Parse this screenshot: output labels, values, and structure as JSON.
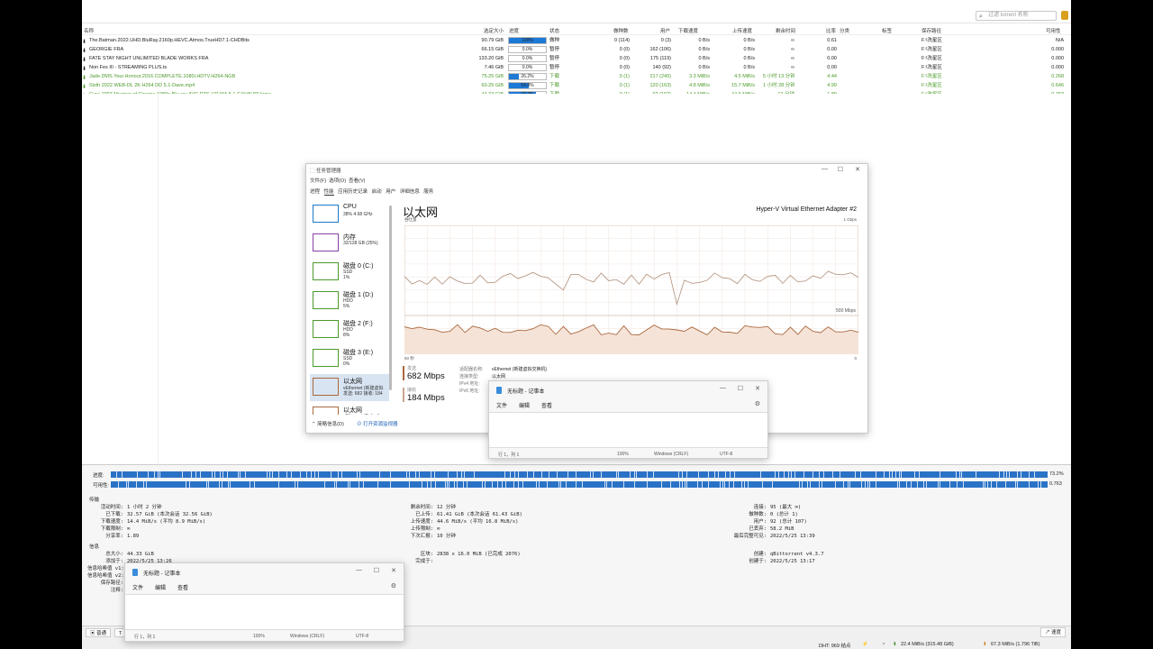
{
  "qb": {
    "search_placeholder": "过滤 torrent 名称",
    "headers": [
      "名称",
      "选定大小",
      "进度",
      "状态",
      "做种数",
      "用户",
      "下载速度",
      "上传速度",
      "剩余时间",
      "比率",
      "分类",
      "标签",
      "保存路径",
      "可用性"
    ],
    "rows": [
      {
        "name": "The.Batman.2022.UHD.BluRay.2160p.HEVC.Atmos.TrueHD7.1-CHDBits",
        "size": "90.79 GiB",
        "progress": 1.0,
        "progress_text": "100%",
        "status": "做种",
        "seeds": "0 (114)",
        "peers": "0 (3)",
        "dl": "0 B/s",
        "ul": "0 B/s",
        "eta": "∞",
        "ratio": "0.61",
        "path": "F:\\洗星区",
        "avail": "N/A",
        "seeding": false
      },
      {
        "name": "GEORGIE FRA",
        "size": "66.15 GiB",
        "progress": 0.0,
        "progress_text": "0.0%",
        "status": "暂停",
        "seeds": "0 (0)",
        "peers": "162 (106)",
        "dl": "0 B/s",
        "ul": "0 B/s",
        "eta": "∞",
        "ratio": "0.00",
        "path": "F:\\洗星区",
        "avail": "0.000",
        "seeding": false
      },
      {
        "name": "FATE STAY NIGHT UNLIMITED BLADE WORKS FRA",
        "size": "133.20 GiB",
        "progress": 0.0,
        "progress_text": "0.0%",
        "status": "暂停",
        "seeds": "0 (0)",
        "peers": "175 (119)",
        "dl": "0 B/s",
        "ul": "0 B/s",
        "eta": "∞",
        "ratio": "0.00",
        "path": "F:\\洗星区",
        "avail": "0.000",
        "seeding": false
      },
      {
        "name": "Non Fes III - STREAMING PLUS.ts",
        "size": "7.46 GiB",
        "progress": 0.0,
        "progress_text": "0.0%",
        "status": "暂停",
        "seeds": "0 (0)",
        "peers": "140 (92)",
        "dl": "0 B/s",
        "ul": "0 B/s",
        "eta": "∞",
        "ratio": "0.00",
        "path": "F:\\洗星区",
        "avail": "0.000",
        "seeding": false
      },
      {
        "name": "Jade.DMS.Your.Honour.2016.COMPLETE.1080i.HDTV.H264-NGB",
        "size": "75.25 GiB",
        "progress": 0.262,
        "progress_text": "26.2%",
        "status": "下载",
        "seeds": "0 (1)",
        "peers": "217 (240)",
        "dl": "3.3 MiB/s",
        "ul": "4.5 MiB/s",
        "eta": "5 小时 13 分钟",
        "ratio": "4.44",
        "path": "F:\\洗星区",
        "avail": "0.268",
        "seeding": true
      },
      {
        "name": "Sixth 2022 WEB-DL 2K H264 DD 5.1-Dave.mp4",
        "size": "60.25 GiB",
        "progress": 0.548,
        "progress_text": "54.8%",
        "status": "下载",
        "seeds": "0 (1)",
        "peers": "120 (163)",
        "dl": "4.8 MiB/s",
        "ul": "15.7 MiB/s",
        "eta": "1 小时 28 分钟",
        "ratio": "4.99",
        "path": "F:\\洗星区",
        "avail": "0.646",
        "seeding": true
      },
      {
        "name": "Cure.1997.Masters.of.Cinema.1080p.Blu-ray.AVC.DTS-HD.MA.5.1-GIY@HDHome",
        "size": "44.33 GiB",
        "progress": 0.732,
        "progress_text": "73.2%",
        "status": "下载",
        "seeds": "0 (1)",
        "peers": "92 (107)",
        "dl": "14.4 MiB/s",
        "ul": "44.6 MiB/s",
        "eta": "12 分钟",
        "ratio": "1.89",
        "path": "F:\\洗星区",
        "avail": "0.763",
        "seeding": true
      }
    ],
    "progress_label": "进度:",
    "progress_value": "73.2%",
    "avail_label": "可用性:",
    "avail_value": "0.763",
    "transfer_header": "传输",
    "transfer_left": [
      {
        "k": "活动时间:",
        "v": "1 小时 2 分钟"
      },
      {
        "k": "已下载:",
        "v": "32.57 GiB (本次会话 32.56 GiB)"
      },
      {
        "k": "下载速度:",
        "v": "14.4 MiB/s (平均 8.9 MiB/s)"
      },
      {
        "k": "下载限制:",
        "v": "∞"
      },
      {
        "k": "分享率:",
        "v": "1.89"
      }
    ],
    "transfer_mid": [
      {
        "k": "剩余时间:",
        "v": "12 分钟"
      },
      {
        "k": "已上传:",
        "v": "61.41 GiB (本次会话 61.43 GiB)"
      },
      {
        "k": "上传速度:",
        "v": "44.6 MiB/s (平均 16.8 MiB/s)"
      },
      {
        "k": "上传限制:",
        "v": "∞"
      },
      {
        "k": "下次汇报:",
        "v": "10 分钟"
      }
    ],
    "transfer_right": [
      {
        "k": "连接:",
        "v": "95 (最大 ∞)"
      },
      {
        "k": "做种数:",
        "v": "0 (总计 1)"
      },
      {
        "k": "用户:",
        "v": "92 (总计 107)"
      },
      {
        "k": "已丢弃:",
        "v": "58.2 MiB"
      },
      {
        "k": "最后完整可见:",
        "v": "2022/5/25 13:39"
      }
    ],
    "info_header": "信息",
    "info_left": [
      {
        "k": "总大小:",
        "v": "44.33 GiB"
      },
      {
        "k": "添加于:",
        "v": "2022/5/25 13:26"
      },
      {
        "k": "信息哈希值 v1:",
        "v": ""
      },
      {
        "k": "信息哈希值 v2:",
        "v": ""
      },
      {
        "k": "保存路径:",
        "v": ""
      },
      {
        "k": "注释:",
        "v": ""
      }
    ],
    "info_mid": [
      {
        "k": "区块:",
        "v": "2838 x 16.0 MiB (已完成 2076)"
      },
      {
        "k": "完成于:",
        "v": ""
      }
    ],
    "info_right": [
      {
        "k": "创建:",
        "v": "qBittorrent v4.3.7"
      },
      {
        "k": "创建于:",
        "v": "2022/5/25 13:17"
      }
    ],
    "tab_general": "普通",
    "tab_second": "T",
    "speed_btn": "速度",
    "sb_dht": "DHT: 969 结点",
    "sb_dl": "22.4 MiB/s (315.48 GiB)",
    "sb_ul": "67.3 MiB/s (1.796 TiB)"
  },
  "tm": {
    "title": "任务管理器",
    "menu": [
      "文件(F)",
      "选项(O)",
      "查看(V)"
    ],
    "tabs": [
      "进程",
      "性能",
      "应用历史记录",
      "启动",
      "用户",
      "详细信息",
      "服务"
    ],
    "side": [
      {
        "name": "CPU",
        "l1": "38% 4.68 GHz",
        "l2": "",
        "l3": "",
        "color": "#1a79c9"
      },
      {
        "name": "内存",
        "l1": "32/128 GB (25%)",
        "l2": "",
        "l3": "",
        "color": "#8b3fa6"
      },
      {
        "name": "磁盘 0 (C:)",
        "l1": "SSD",
        "l2": "1%",
        "l3": "",
        "color": "#4b9a2b"
      },
      {
        "name": "磁盘 1 (D:)",
        "l1": "HDD",
        "l2": "5%",
        "l3": "",
        "color": "#4b9a2b"
      },
      {
        "name": "磁盘 2 (F:)",
        "l1": "HDD",
        "l2": "8%",
        "l3": "",
        "color": "#4b9a2b"
      },
      {
        "name": "磁盘 3 (E:)",
        "l1": "SSD",
        "l2": "0%",
        "l3": "",
        "color": "#4b9a2b"
      },
      {
        "name": "以太网",
        "l1": "vEthernet (新建虚拟",
        "l2": "发送: 682 接收: 184",
        "l3": "",
        "color": "#a9683e"
      },
      {
        "name": "以太网",
        "l1": "vEthernet (Default",
        "l2": "",
        "l3": "",
        "color": "#a9683e"
      }
    ],
    "big_title": "以太网",
    "adapter": "Hyper-V Virtual Ethernet Adapter #2",
    "throughput_label": "吞吐量",
    "max_label": "1 Gbps",
    "mid_label": "500 Mbps",
    "sixty": "60 秒",
    "zero": "0",
    "send_label": "发送",
    "send_value": "682 Mbps",
    "recv_label": "接收",
    "recv_value": "184 Mbps",
    "details": [
      {
        "k": "适配器名称:",
        "v": "vEthernet (新建虚拟交换机)"
      },
      {
        "k": "连接类型:",
        "v": "以太网"
      },
      {
        "k": "IPv4 地址:",
        "v": ""
      },
      {
        "k": "IPv6 地址:",
        "v": ""
      }
    ],
    "less": "简略信息(D)",
    "open_monitor": "打开资源监视器"
  },
  "notepad1": {
    "title": "无标题 - 记事本",
    "menu": [
      "文件",
      "编辑",
      "查看"
    ],
    "pos": "行 1，列 1",
    "zoom": "100%",
    "eol": "Windows (CRLF)",
    "enc": "UTF-8"
  },
  "notepad2": {
    "title": "无标题 - 记事本",
    "menu": [
      "文件",
      "编辑",
      "查看"
    ],
    "pos": "行 1，列 1",
    "zoom": "100%",
    "eol": "Windows (CRLF)",
    "enc": "UTF-8"
  }
}
